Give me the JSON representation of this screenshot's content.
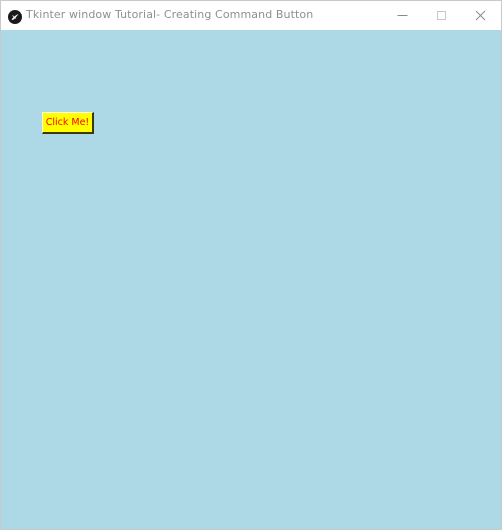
{
  "window": {
    "title": "Tkinter window Tutorial- Creating Command Button",
    "app_icon": "tkinter-feather-icon",
    "controls": {
      "minimize_icon": "minimize-icon",
      "maximize_icon": "maximize-icon",
      "close_icon": "close-icon"
    },
    "background_color": "#add8e6"
  },
  "button": {
    "label": "Click Me!",
    "background_color": "#ffff00",
    "text_color": "#ff0000"
  }
}
